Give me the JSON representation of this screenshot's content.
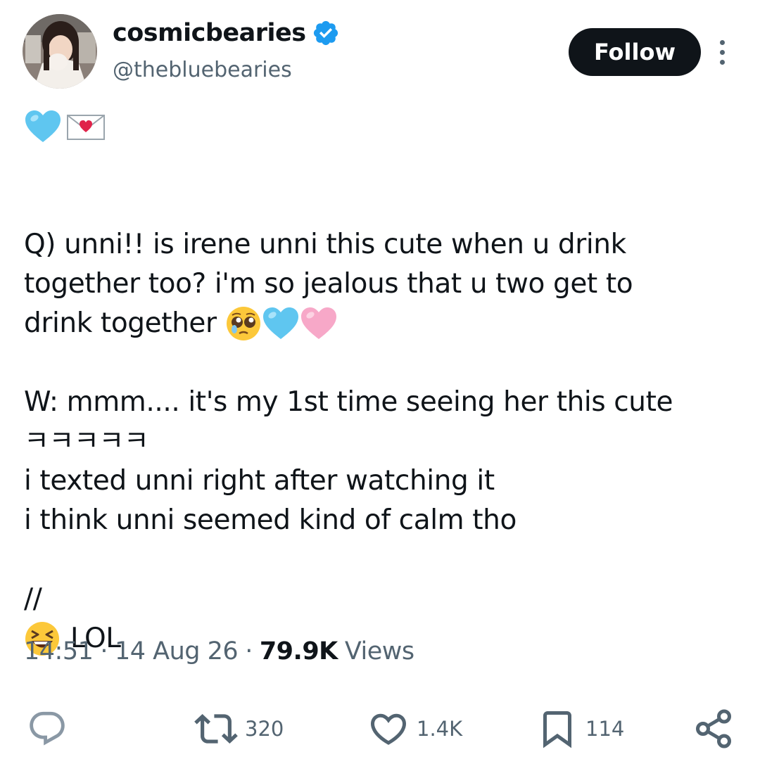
{
  "user": {
    "display_name": "cosmicbearies",
    "handle": "@thebluebearies",
    "verified_icon": "verified-badge-icon",
    "avatar_icon": "avatar-photo"
  },
  "header": {
    "follow_label": "Follow",
    "more_icon": "more-vertical-icon"
  },
  "tweet": {
    "emoji_line": [
      "light-blue-heart",
      "love-letter"
    ],
    "q_line1": "Q) unni!! is irene unni this cute when u drink",
    "q_line2": "together too? i'm so jealous that u two get to",
    "q_line3": "drink together",
    "q_line3_emojis": [
      "pleading-face",
      "light-blue-heart",
      "pink-heart"
    ],
    "w_line1": "W: mmm.... it's my 1st time seeing her this cute",
    "w_line2": "ㅋㅋㅋㅋㅋ",
    "w_line3": "i texted unni right after watching it",
    "w_line4": "i think unni seemed kind of calm tho",
    "sep": "//",
    "lol_emoji": "grinning-squinting-face",
    "lol_text": "LOL"
  },
  "meta": {
    "time": "14:51",
    "date": "14 Aug 26",
    "views_count": "79.9K",
    "views_label": "Views",
    "separator": "·"
  },
  "actions": {
    "reply_icon": "reply-icon",
    "retweet_icon": "retweet-icon",
    "retweet_count": "320",
    "like_icon": "heart-icon",
    "like_count": "1.4K",
    "bookmark_icon": "bookmark-icon",
    "bookmark_count": "114",
    "share_icon": "share-icon"
  },
  "colors": {
    "text_primary": "#0f1419",
    "text_secondary": "#536471",
    "verified_blue": "#1d9bf0",
    "follow_bg": "#0f1419"
  }
}
